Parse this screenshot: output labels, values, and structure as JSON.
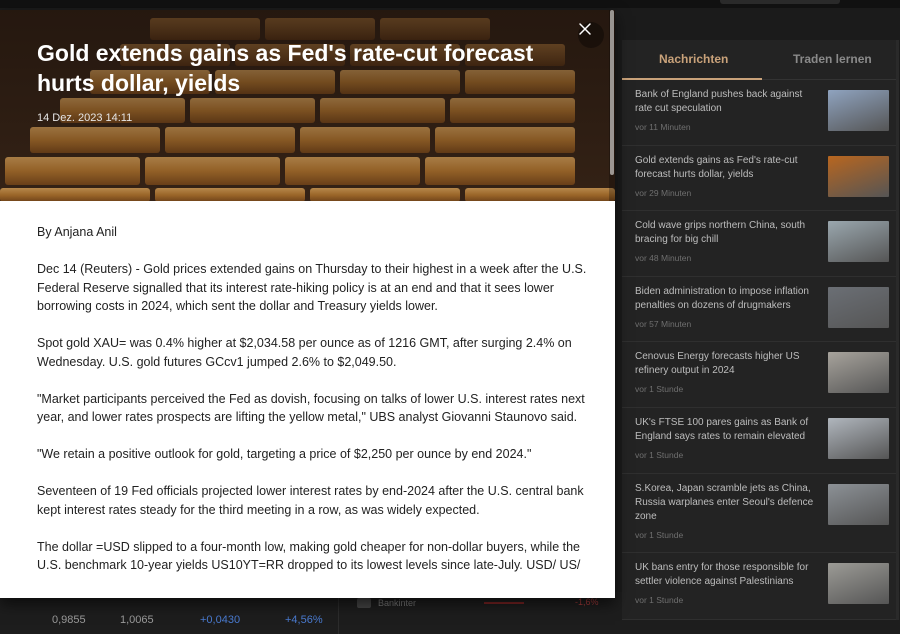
{
  "article": {
    "title": "Gold extends gains as Fed's rate-cut forecast hurts dollar, yields",
    "date": "14 Dez. 2023 14:11",
    "paragraphs": [
      "By Anjana Anil",
      "Dec 14 (Reuters) - Gold prices extended gains on Thursday to their highest in a week after the U.S. Federal Reserve signalled that its interest rate-hiking policy is at an end and that it sees lower borrowing costs in 2024, which sent the dollar and Treasury yields lower.",
      "Spot gold XAU= was 0.4% higher at $2,034.58 per ounce as of 1216 GMT, after surging 2.4% on Wednesday. U.S. gold futures GCcv1 jumped 2.6% to $2,049.50.",
      "\"Market participants perceived the Fed as dovish, focusing on talks of lower U.S. interest rates next year, and lower rates prospects are lifting the yellow metal,\" UBS analyst Giovanni Staunovo said.",
      "\"We retain a positive outlook for gold, targeting a price of $2,250 per ounce by end 2024.\"",
      "Seventeen of 19 Fed officials projected lower interest rates by end-2024 after the U.S. central bank kept interest rates steady for the third meeting in a row, as was widely expected.",
      "The dollar =USD slipped to a four-month low, making gold cheaper for non-dollar buyers, while the U.S. benchmark 10-year yields US10YT=RR dropped to its lowest levels since late-July. USD/ US/"
    ],
    "close_icon": "close-icon"
  },
  "panel": {
    "tabs": [
      "Nachrichten",
      "Traden lernen"
    ],
    "news": [
      {
        "title": "Bank of England pushes back against rate cut speculation",
        "time": "vor 11 Minuten",
        "thumb": "#8fa3bf"
      },
      {
        "title": "Gold extends gains as Fed's rate-cut forecast hurts dollar, yields",
        "time": "vor 29 Minuten",
        "thumb": "#b8661f"
      },
      {
        "title": "Cold wave grips northern China, south bracing for big chill",
        "time": "vor 48 Minuten",
        "thumb": "#9aa7ae"
      },
      {
        "title": "Biden administration to impose inflation penalties on dozens of drugmakers",
        "time": "vor 57 Minuten",
        "thumb": "#6b6f75"
      },
      {
        "title": "Cenovus Energy forecasts higher US refinery output in 2024",
        "time": "vor 1 Stunde",
        "thumb": "#a7a39c"
      },
      {
        "title": "UK's FTSE 100 pares gains as Bank of England says rates to remain elevated",
        "time": "vor 1 Stunde",
        "thumb": "#b0b6bd"
      },
      {
        "title": "S.Korea, Japan scramble jets as China, Russia warplanes enter Seoul's defence zone",
        "time": "vor 1 Stunde",
        "thumb": "#8c9196"
      },
      {
        "title": "UK bans entry for those responsible for settler violence against Palestinians",
        "time": "vor 1 Stunde",
        "thumb": "#9c9b96"
      }
    ]
  },
  "background": {
    "values": [
      "0,9855",
      "1,0065",
      "+0,0430",
      "+4,56%"
    ],
    "bank_label": "Bankinter",
    "neg_value": "-1,6%"
  }
}
